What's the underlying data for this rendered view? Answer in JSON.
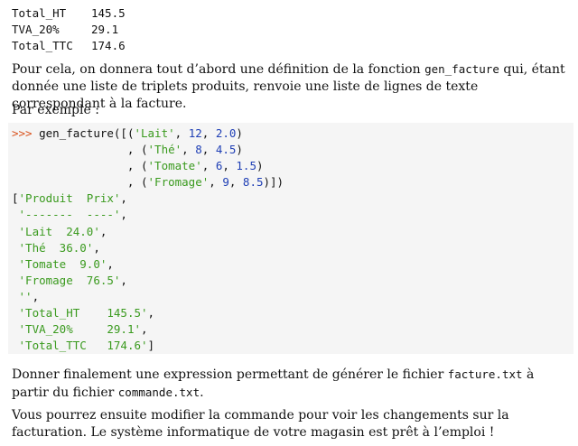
{
  "totals": [
    {
      "label": "Total_HT",
      "value": "145.5"
    },
    {
      "label": "TVA_20%",
      "value": "29.1"
    },
    {
      "label": "Total_TTC",
      "value": "174.6"
    }
  ],
  "para1": {
    "pre": "Pour cela, on donnera tout d’abord une définition de la fonction ",
    "code": "gen_facture",
    "post": " qui, étant donnée une liste de triplets produits, renvoie une liste de lignes de texte correspondant à la facture."
  },
  "para2": "Par exemple :",
  "code_block": {
    "prompt": ">>>",
    "func": "gen_facture",
    "call_rows": [
      {
        "lead": "",
        "name": "'Lait'",
        "qty": "12",
        "price": "2.0",
        "close": ")"
      },
      {
        "lead": "                 , ",
        "name": "'Thé'",
        "qty": "8",
        "price": "4.5",
        "close": ")"
      },
      {
        "lead": "                 , ",
        "name": "'Tomate'",
        "qty": "6",
        "price": "1.5",
        "close": ")"
      },
      {
        "lead": "                 , ",
        "name": "'Fromage'",
        "qty": "9",
        "price": "8.5",
        "close": ")])"
      }
    ],
    "output": [
      "'Produit  Prix'",
      "'-------  ----'",
      "'Lait  24.0'",
      "'Thé  36.0'",
      "'Tomate  9.0'",
      "'Fromage  76.5'",
      "''",
      "'Total_HT    145.5'",
      "'TVA_20%     29.1'",
      "'Total_TTC   174.6'"
    ]
  },
  "para3": {
    "pre": "Donner finalement une expression permettant de générer le fichier ",
    "code1": "facture.txt",
    "mid": " à partir du fichier ",
    "code2": "commande.txt",
    "post": "."
  },
  "para4": "Vous pourrez ensuite modifier la commande pour voir les changements sur la facturation. Le système informatique de votre magasin est prêt à l’emploi !",
  "colors": {
    "prompt": "#d9531e",
    "string": "#3a9a1e",
    "number": "#1f3fb5",
    "code_bg": "#f5f5f5"
  }
}
